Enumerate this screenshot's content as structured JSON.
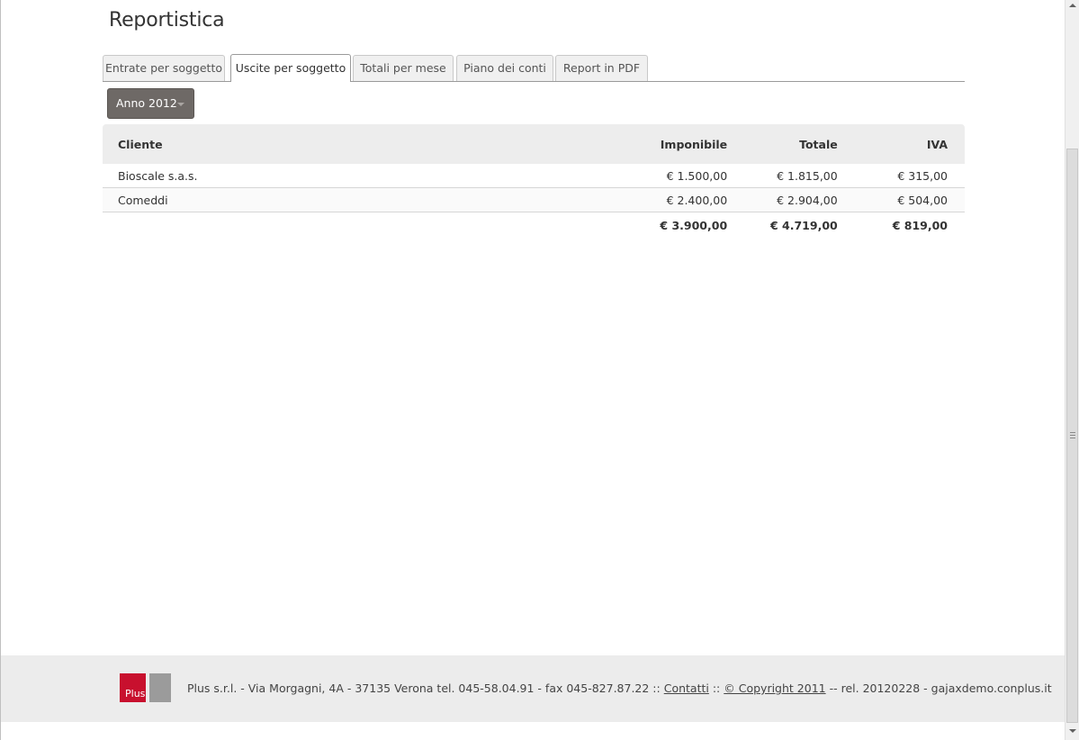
{
  "page": {
    "title": "Reportistica"
  },
  "tabs": [
    {
      "label": "Entrate per soggetto",
      "active": false
    },
    {
      "label": "Uscite per soggetto",
      "active": true
    },
    {
      "label": "Totali per mese",
      "active": false
    },
    {
      "label": "Piano dei conti",
      "active": false
    },
    {
      "label": "Report in PDF",
      "active": false
    }
  ],
  "year_selector": {
    "label": "Anno 2012"
  },
  "table": {
    "headers": {
      "cliente": "Cliente",
      "imponibile": "Imponibile",
      "totale": "Totale",
      "iva": "IVA"
    },
    "rows": [
      {
        "cliente": "Bioscale s.a.s.",
        "imponibile": "€ 1.500,00",
        "totale": "€ 1.815,00",
        "iva": "€ 315,00"
      },
      {
        "cliente": "Comeddi",
        "imponibile": "€ 2.400,00",
        "totale": "€ 2.904,00",
        "iva": "€ 504,00"
      }
    ],
    "totals": {
      "imponibile": "€ 3.900,00",
      "totale": "€ 4.719,00",
      "iva": "€ 819,00"
    }
  },
  "footer": {
    "logo_text": "Plus",
    "address": "Plus s.r.l. - Via Morgagni, 4A - 37135 Verona tel. 045-58.04.91 - fax 045-827.87.22 ::",
    "contatti_link": "Contatti",
    "separator": "::",
    "copyright_link": "© Copyright 2011",
    "release": "-- rel. 20120228 - gajaxdemo.conplus.it"
  },
  "colors": {
    "year_button_bg": "#6e6966",
    "table_header_bg": "#ededed",
    "footer_bg": "#ececec",
    "logo_red": "#c8102e",
    "logo_grey": "#9b9b9b"
  }
}
